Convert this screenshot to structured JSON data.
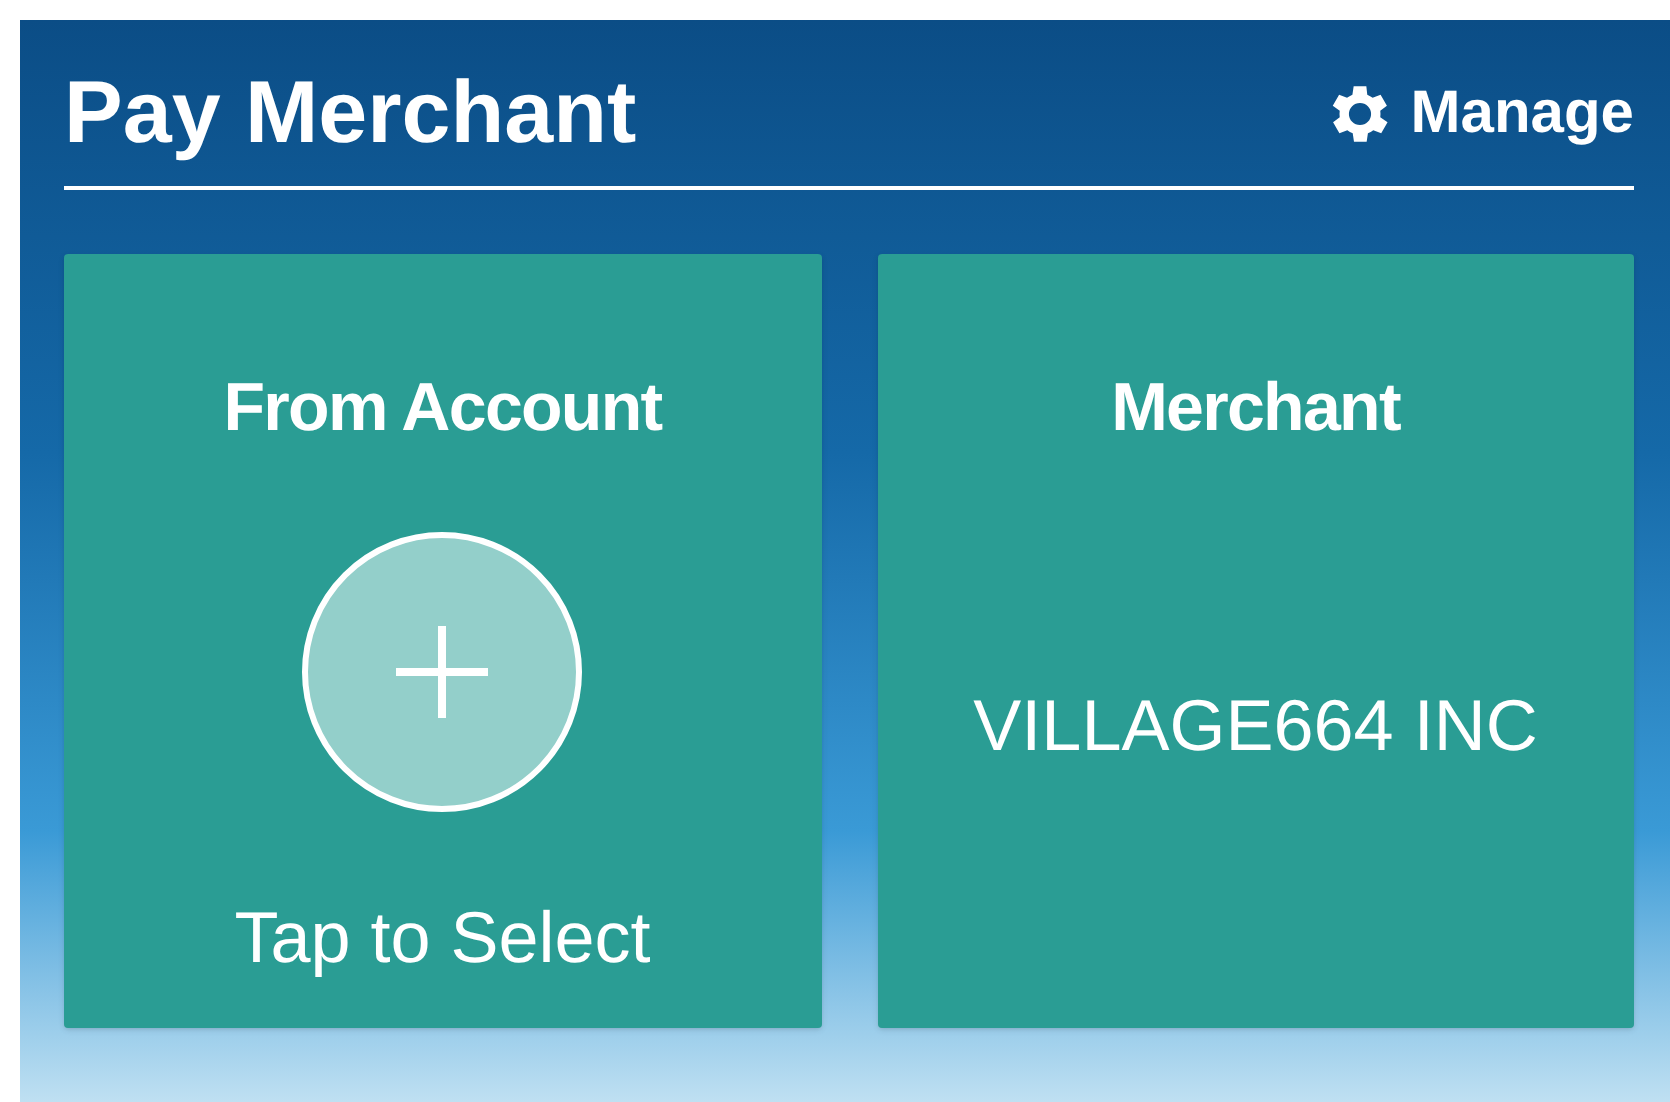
{
  "header": {
    "title": "Pay Merchant",
    "manage_label": "Manage"
  },
  "cards": [
    {
      "kind": "select",
      "title": "From Account",
      "label": "Tap to Select"
    },
    {
      "kind": "value",
      "title": "Merchant",
      "value": "VILLAGE664 INC"
    }
  ]
}
